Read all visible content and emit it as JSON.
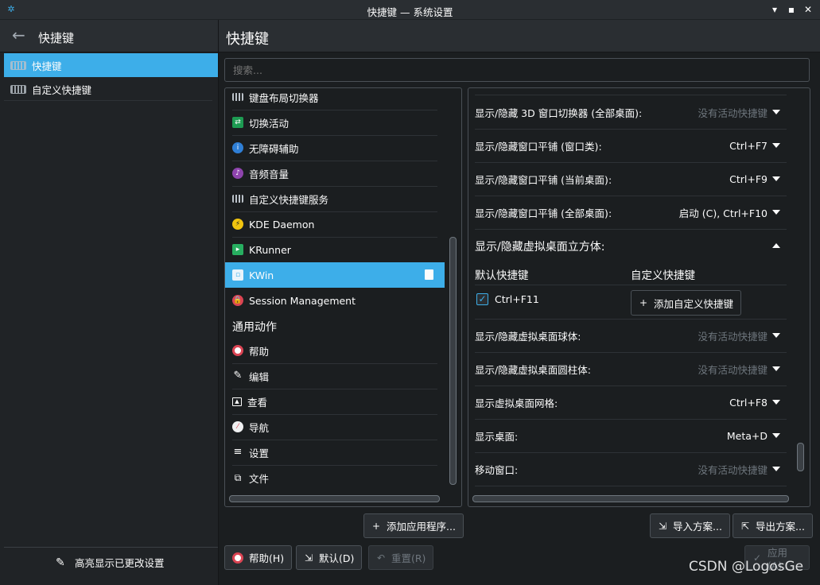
{
  "window": {
    "title": "快捷键 — 系统设置",
    "minimize_icon": "minimize-icon",
    "maximize_icon": "maximize-icon",
    "close_icon": "close-icon"
  },
  "sidebar": {
    "title": "快捷键",
    "items": [
      {
        "label": "快捷键",
        "icon": "keyboard-icon",
        "active": true
      },
      {
        "label": "自定义快捷键",
        "icon": "keyboard-icon",
        "active": false
      }
    ],
    "highlight_label": "高亮显示已更改设置"
  },
  "main": {
    "title": "快捷键",
    "search_placeholder": "搜索..."
  },
  "components": {
    "items": [
      {
        "label": "键盘布局切换器",
        "icon": "keyboard-icon"
      },
      {
        "label": "切换活动",
        "icon": "activities-icon"
      },
      {
        "label": "无障碍辅助",
        "icon": "accessibility-icon"
      },
      {
        "label": "音频音量",
        "icon": "audio-volume-icon"
      },
      {
        "label": "自定义快捷键服务",
        "icon": "keyboard-icon"
      },
      {
        "label": "KDE Daemon",
        "icon": "kde-daemon-icon"
      },
      {
        "label": "KRunner",
        "icon": "krunner-icon"
      },
      {
        "label": "KWin",
        "icon": "kwin-icon",
        "active": true
      },
      {
        "label": "Session Management",
        "icon": "lock-icon"
      }
    ],
    "group_title": "通用动作",
    "common": [
      {
        "label": "帮助",
        "icon": "help-lifebuoy-icon"
      },
      {
        "label": "编辑",
        "icon": "edit-pencil-icon"
      },
      {
        "label": "查看",
        "icon": "view-image-icon"
      },
      {
        "label": "导航",
        "icon": "compass-icon"
      },
      {
        "label": "设置",
        "icon": "settings-lines-icon"
      },
      {
        "label": "文件",
        "icon": "file-copy-icon"
      }
    ]
  },
  "shortcuts": {
    "rows_top": [
      {
        "label": "显示/隐藏 3D 窗口切换器 (全部桌面):",
        "value": "没有活动快捷键",
        "muted": true
      },
      {
        "label": "显示/隐藏窗口平铺 (窗口类):",
        "value": "Ctrl+F7",
        "muted": false
      },
      {
        "label": "显示/隐藏窗口平铺 (当前桌面):",
        "value": "Ctrl+F9",
        "muted": false
      },
      {
        "label": "显示/隐藏窗口平铺 (全部桌面):",
        "value": "启动 (C), Ctrl+F10",
        "muted": false
      }
    ],
    "expanded": {
      "title": "显示/隐藏虚拟桌面立方体:",
      "default_header": "默认快捷键",
      "custom_header": "自定义快捷键",
      "default_value": "Ctrl+F11",
      "default_checked": true,
      "add_custom_label": "添加自定义快捷键"
    },
    "rows_bottom": [
      {
        "label": "显示/隐藏虚拟桌面球体:",
        "value": "没有活动快捷键",
        "muted": true
      },
      {
        "label": "显示/隐藏虚拟桌面圆柱体:",
        "value": "没有活动快捷键",
        "muted": true
      },
      {
        "label": "显示虚拟桌面网格:",
        "value": "Ctrl+F8",
        "muted": false
      },
      {
        "label": "显示桌面:",
        "value": "Meta+D",
        "muted": false
      },
      {
        "label": "移动窗口:",
        "value": "没有活动快捷键",
        "muted": true
      }
    ]
  },
  "buttons": {
    "add_app": "添加应用程序...",
    "import_scheme": "导入方案...",
    "export_scheme": "导出方案...",
    "help": "帮助(H)",
    "defaults": "默认(D)",
    "reset": "重置(R)",
    "apply": "应用(A)"
  },
  "watermark": "CSDN @LogosGe",
  "colors": {
    "accent": "#3daee9",
    "background": "#1b1e20",
    "header": "#2a2e32",
    "muted_text": "#6e767d"
  }
}
